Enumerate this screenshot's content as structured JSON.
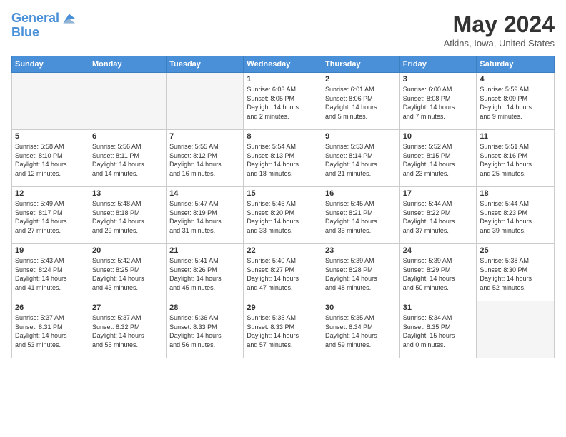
{
  "logo": {
    "line1": "General",
    "line2": "Blue"
  },
  "title": "May 2024",
  "location": "Atkins, Iowa, United States",
  "days_header": [
    "Sunday",
    "Monday",
    "Tuesday",
    "Wednesday",
    "Thursday",
    "Friday",
    "Saturday"
  ],
  "weeks": [
    [
      {
        "day": "",
        "info": ""
      },
      {
        "day": "",
        "info": ""
      },
      {
        "day": "",
        "info": ""
      },
      {
        "day": "1",
        "info": "Sunrise: 6:03 AM\nSunset: 8:05 PM\nDaylight: 14 hours\nand 2 minutes."
      },
      {
        "day": "2",
        "info": "Sunrise: 6:01 AM\nSunset: 8:06 PM\nDaylight: 14 hours\nand 5 minutes."
      },
      {
        "day": "3",
        "info": "Sunrise: 6:00 AM\nSunset: 8:08 PM\nDaylight: 14 hours\nand 7 minutes."
      },
      {
        "day": "4",
        "info": "Sunrise: 5:59 AM\nSunset: 8:09 PM\nDaylight: 14 hours\nand 9 minutes."
      }
    ],
    [
      {
        "day": "5",
        "info": "Sunrise: 5:58 AM\nSunset: 8:10 PM\nDaylight: 14 hours\nand 12 minutes."
      },
      {
        "day": "6",
        "info": "Sunrise: 5:56 AM\nSunset: 8:11 PM\nDaylight: 14 hours\nand 14 minutes."
      },
      {
        "day": "7",
        "info": "Sunrise: 5:55 AM\nSunset: 8:12 PM\nDaylight: 14 hours\nand 16 minutes."
      },
      {
        "day": "8",
        "info": "Sunrise: 5:54 AM\nSunset: 8:13 PM\nDaylight: 14 hours\nand 18 minutes."
      },
      {
        "day": "9",
        "info": "Sunrise: 5:53 AM\nSunset: 8:14 PM\nDaylight: 14 hours\nand 21 minutes."
      },
      {
        "day": "10",
        "info": "Sunrise: 5:52 AM\nSunset: 8:15 PM\nDaylight: 14 hours\nand 23 minutes."
      },
      {
        "day": "11",
        "info": "Sunrise: 5:51 AM\nSunset: 8:16 PM\nDaylight: 14 hours\nand 25 minutes."
      }
    ],
    [
      {
        "day": "12",
        "info": "Sunrise: 5:49 AM\nSunset: 8:17 PM\nDaylight: 14 hours\nand 27 minutes."
      },
      {
        "day": "13",
        "info": "Sunrise: 5:48 AM\nSunset: 8:18 PM\nDaylight: 14 hours\nand 29 minutes."
      },
      {
        "day": "14",
        "info": "Sunrise: 5:47 AM\nSunset: 8:19 PM\nDaylight: 14 hours\nand 31 minutes."
      },
      {
        "day": "15",
        "info": "Sunrise: 5:46 AM\nSunset: 8:20 PM\nDaylight: 14 hours\nand 33 minutes."
      },
      {
        "day": "16",
        "info": "Sunrise: 5:45 AM\nSunset: 8:21 PM\nDaylight: 14 hours\nand 35 minutes."
      },
      {
        "day": "17",
        "info": "Sunrise: 5:44 AM\nSunset: 8:22 PM\nDaylight: 14 hours\nand 37 minutes."
      },
      {
        "day": "18",
        "info": "Sunrise: 5:44 AM\nSunset: 8:23 PM\nDaylight: 14 hours\nand 39 minutes."
      }
    ],
    [
      {
        "day": "19",
        "info": "Sunrise: 5:43 AM\nSunset: 8:24 PM\nDaylight: 14 hours\nand 41 minutes."
      },
      {
        "day": "20",
        "info": "Sunrise: 5:42 AM\nSunset: 8:25 PM\nDaylight: 14 hours\nand 43 minutes."
      },
      {
        "day": "21",
        "info": "Sunrise: 5:41 AM\nSunset: 8:26 PM\nDaylight: 14 hours\nand 45 minutes."
      },
      {
        "day": "22",
        "info": "Sunrise: 5:40 AM\nSunset: 8:27 PM\nDaylight: 14 hours\nand 47 minutes."
      },
      {
        "day": "23",
        "info": "Sunrise: 5:39 AM\nSunset: 8:28 PM\nDaylight: 14 hours\nand 48 minutes."
      },
      {
        "day": "24",
        "info": "Sunrise: 5:39 AM\nSunset: 8:29 PM\nDaylight: 14 hours\nand 50 minutes."
      },
      {
        "day": "25",
        "info": "Sunrise: 5:38 AM\nSunset: 8:30 PM\nDaylight: 14 hours\nand 52 minutes."
      }
    ],
    [
      {
        "day": "26",
        "info": "Sunrise: 5:37 AM\nSunset: 8:31 PM\nDaylight: 14 hours\nand 53 minutes."
      },
      {
        "day": "27",
        "info": "Sunrise: 5:37 AM\nSunset: 8:32 PM\nDaylight: 14 hours\nand 55 minutes."
      },
      {
        "day": "28",
        "info": "Sunrise: 5:36 AM\nSunset: 8:33 PM\nDaylight: 14 hours\nand 56 minutes."
      },
      {
        "day": "29",
        "info": "Sunrise: 5:35 AM\nSunset: 8:33 PM\nDaylight: 14 hours\nand 57 minutes."
      },
      {
        "day": "30",
        "info": "Sunrise: 5:35 AM\nSunset: 8:34 PM\nDaylight: 14 hours\nand 59 minutes."
      },
      {
        "day": "31",
        "info": "Sunrise: 5:34 AM\nSunset: 8:35 PM\nDaylight: 15 hours\nand 0 minutes."
      },
      {
        "day": "",
        "info": ""
      }
    ]
  ]
}
